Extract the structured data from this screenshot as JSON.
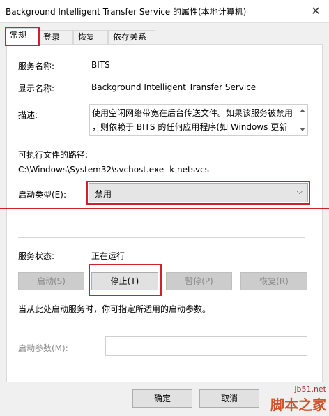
{
  "window": {
    "title": "Background Intelligent Transfer Service 的属性(本地计算机)",
    "close_glyph": "✕"
  },
  "tabs": [
    {
      "label": "常规",
      "active": true
    },
    {
      "label": "登录",
      "active": false
    },
    {
      "label": "恢复",
      "active": false
    },
    {
      "label": "依存关系",
      "active": false
    }
  ],
  "general": {
    "service_name_label": "服务名称:",
    "service_name": "BITS",
    "display_name_label": "显示名称:",
    "display_name": "Background Intelligent Transfer Service",
    "description_label": "描述:",
    "description_line1": "使用空闲网络带宽在后台传送文件。如果该服务被禁用",
    "description_line2": "，则依赖于 BITS 的任何应用程序(如 Windows 更新",
    "exe_path_label": "可执行文件的路径:",
    "exe_path": "C:\\Windows\\System32\\svchost.exe -k netsvcs",
    "startup_type_label": "启动类型(E):",
    "startup_type_value": "禁用",
    "status_label": "服务状态:",
    "status_value": "正在运行",
    "start_button": "启动(S)",
    "stop_button": "停止(T)",
    "pause_button": "暂停(P)",
    "resume_button": "恢复(R)",
    "hint_text": "当从此处启动服务时，你可指定所适用的启动参数。",
    "start_params_label": "启动参数(M):",
    "start_params_value": ""
  },
  "footer": {
    "ok_button": "确定",
    "cancel_button": "取消"
  },
  "watermark": {
    "url": "jb51.net",
    "name": "脚本之家"
  },
  "colors": {
    "highlight_red": "#d0202a",
    "dialog_bg": "#f0f0f0",
    "panel_bg": "#ffffff"
  }
}
